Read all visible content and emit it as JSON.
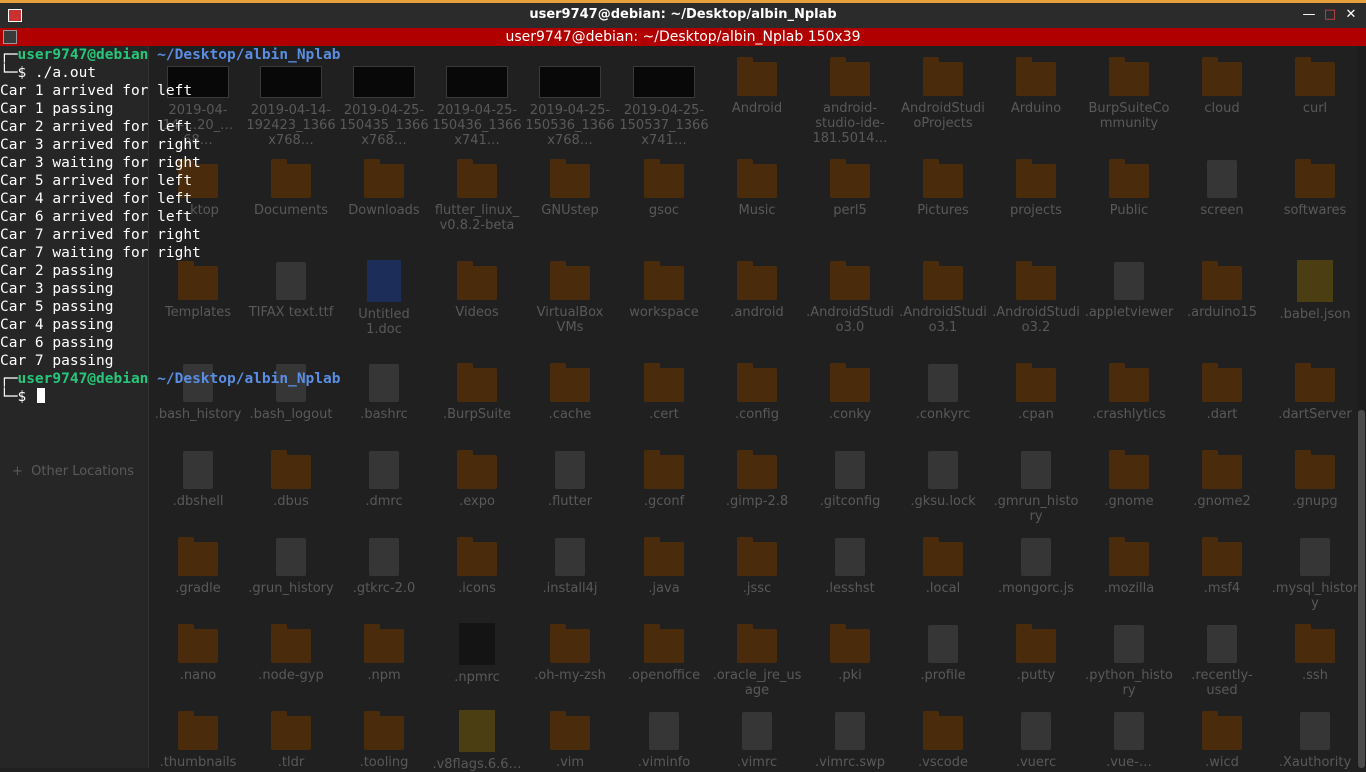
{
  "window": {
    "title": "user9747@debian: ~/Desktop/albin_Nplab"
  },
  "terminal": {
    "title": "user9747@debian: ~/Desktop/albin_Nplab 150x39",
    "prompt1": {
      "user": "user9747@debian",
      "path": "~/Desktop/albin_Nplab",
      "command": "./a.out"
    },
    "output": [
      "Car 1 arrived for left",
      "Car 1 passing",
      "Car 2 arrived for left",
      "Car 3 arrived for right",
      "Car 3 waiting for right",
      "Car 5 arrived for left",
      "Car 4 arrived for left",
      "Car 6 arrived for left",
      "Car 7 arrived for right",
      "Car 7 waiting for right",
      "Car 2 passing",
      "Car 3 passing",
      "Car 5 passing",
      "Car 4 passing",
      "Car 6 passing",
      "Car 7 passing"
    ],
    "prompt2": {
      "user": "user9747@debian",
      "path": "~/Desktop/albin_Nplab"
    }
  },
  "sidebar": {
    "other_locations": "Other Locations"
  },
  "files": [
    {
      "label": "2019-04-14-…20_…68…",
      "type": "thumb"
    },
    {
      "label": "2019-04-14-192423_1366x768…",
      "type": "thumb"
    },
    {
      "label": "2019-04-25-150435_1366x768…",
      "type": "thumb"
    },
    {
      "label": "2019-04-25-150436_1366x741…",
      "type": "thumb"
    },
    {
      "label": "2019-04-25-150536_1366x768…",
      "type": "thumb"
    },
    {
      "label": "2019-04-25-150537_1366x741…",
      "type": "thumb"
    },
    {
      "label": "Android",
      "type": "folder"
    },
    {
      "label": "android-studio-ide-181.5014…",
      "type": "folder"
    },
    {
      "label": "AndroidStudioProjects",
      "type": "folder"
    },
    {
      "label": "Arduino",
      "type": "folder"
    },
    {
      "label": "BurpSuiteCommunity",
      "type": "folder"
    },
    {
      "label": "cloud",
      "type": "folder"
    },
    {
      "label": "curl",
      "type": "folder"
    },
    {
      "label": "…ktop",
      "type": "folder"
    },
    {
      "label": "Documents",
      "type": "folder"
    },
    {
      "label": "Downloads",
      "type": "folder"
    },
    {
      "label": "flutter_linux_v0.8.2-beta",
      "type": "folder"
    },
    {
      "label": "GNUstep",
      "type": "folder"
    },
    {
      "label": "gsoc",
      "type": "folder"
    },
    {
      "label": "Music",
      "type": "folder"
    },
    {
      "label": "perl5",
      "type": "folder"
    },
    {
      "label": "Pictures",
      "type": "folder"
    },
    {
      "label": "projects",
      "type": "folder"
    },
    {
      "label": "Public",
      "type": "folder"
    },
    {
      "label": "screen",
      "type": "file"
    },
    {
      "label": "softwares",
      "type": "folder"
    },
    {
      "label": "Templates",
      "type": "folder"
    },
    {
      "label": "TIFAX text.ttf",
      "type": "file"
    },
    {
      "label": "Untitled 1.doc",
      "type": "doc"
    },
    {
      "label": "Videos",
      "type": "folder"
    },
    {
      "label": "VirtualBox VMs",
      "type": "folder"
    },
    {
      "label": "workspace",
      "type": "folder"
    },
    {
      "label": ".android",
      "type": "folder"
    },
    {
      "label": ".AndroidStudio3.0",
      "type": "folder"
    },
    {
      "label": ".AndroidStudio3.1",
      "type": "folder"
    },
    {
      "label": ".AndroidStudio3.2",
      "type": "folder"
    },
    {
      "label": ".appletviewer",
      "type": "file"
    },
    {
      "label": ".arduino15",
      "type": "folder"
    },
    {
      "label": ".babel.json",
      "type": "flutter"
    },
    {
      "label": ".bash_history",
      "type": "file"
    },
    {
      "label": ".bash_logout",
      "type": "file"
    },
    {
      "label": ".bashrc",
      "type": "file"
    },
    {
      "label": ".BurpSuite",
      "type": "folder"
    },
    {
      "label": ".cache",
      "type": "folder"
    },
    {
      "label": ".cert",
      "type": "folder"
    },
    {
      "label": ".config",
      "type": "folder"
    },
    {
      "label": ".conky",
      "type": "folder"
    },
    {
      "label": ".conkyrc",
      "type": "file"
    },
    {
      "label": ".cpan",
      "type": "folder"
    },
    {
      "label": ".crashlytics",
      "type": "folder"
    },
    {
      "label": ".dart",
      "type": "folder"
    },
    {
      "label": ".dartServer",
      "type": "folder"
    },
    {
      "label": ".dbshell",
      "type": "file"
    },
    {
      "label": ".dbus",
      "type": "folder"
    },
    {
      "label": ".dmrc",
      "type": "file"
    },
    {
      "label": ".expo",
      "type": "folder"
    },
    {
      "label": ".flutter",
      "type": "file"
    },
    {
      "label": ".gconf",
      "type": "folder"
    },
    {
      "label": ".gimp-2.8",
      "type": "folder"
    },
    {
      "label": ".gitconfig",
      "type": "file"
    },
    {
      "label": ".gksu.lock",
      "type": "file"
    },
    {
      "label": ".gmrun_history",
      "type": "file"
    },
    {
      "label": ".gnome",
      "type": "folder"
    },
    {
      "label": ".gnome2",
      "type": "folder"
    },
    {
      "label": ".gnupg",
      "type": "folder"
    },
    {
      "label": ".gradle",
      "type": "folder"
    },
    {
      "label": ".grun_history",
      "type": "file"
    },
    {
      "label": ".gtkrc-2.0",
      "type": "file"
    },
    {
      "label": ".icons",
      "type": "folder"
    },
    {
      "label": ".install4j",
      "type": "file"
    },
    {
      "label": ".java",
      "type": "folder"
    },
    {
      "label": ".jssc",
      "type": "folder"
    },
    {
      "label": ".lesshst",
      "type": "file"
    },
    {
      "label": ".local",
      "type": "folder"
    },
    {
      "label": ".mongorc.js",
      "type": "file"
    },
    {
      "label": ".mozilla",
      "type": "folder"
    },
    {
      "label": ".msf4",
      "type": "folder"
    },
    {
      "label": ".mysql_history",
      "type": "file"
    },
    {
      "label": ".nano",
      "type": "folder"
    },
    {
      "label": ".node-gyp",
      "type": "folder"
    },
    {
      "label": ".npm",
      "type": "folder"
    },
    {
      "label": ".npmrc",
      "type": "cfile"
    },
    {
      "label": ".oh-my-zsh",
      "type": "folder"
    },
    {
      "label": ".openoffice",
      "type": "folder"
    },
    {
      "label": ".oracle_jre_usage",
      "type": "folder"
    },
    {
      "label": ".pki",
      "type": "folder"
    },
    {
      "label": ".profile",
      "type": "file"
    },
    {
      "label": ".putty",
      "type": "folder"
    },
    {
      "label": ".python_history",
      "type": "file"
    },
    {
      "label": ".recently-used",
      "type": "file"
    },
    {
      "label": ".ssh",
      "type": "folder"
    },
    {
      "label": ".thumbnails",
      "type": "folder"
    },
    {
      "label": ".tldr",
      "type": "folder"
    },
    {
      "label": ".tooling",
      "type": "folder"
    },
    {
      "label": ".v8flags.6.6…",
      "type": "flutter"
    },
    {
      "label": ".vim",
      "type": "folder"
    },
    {
      "label": ".viminfo",
      "type": "file"
    },
    {
      "label": ".vimrc",
      "type": "file"
    },
    {
      "label": ".vimrc.swp",
      "type": "file"
    },
    {
      "label": ".vscode",
      "type": "folder"
    },
    {
      "label": ".vuerc",
      "type": "file"
    },
    {
      "label": ".vue-…",
      "type": "file"
    },
    {
      "label": ".wicd",
      "type": "folder"
    },
    {
      "label": ".Xauthority",
      "type": "file"
    }
  ]
}
